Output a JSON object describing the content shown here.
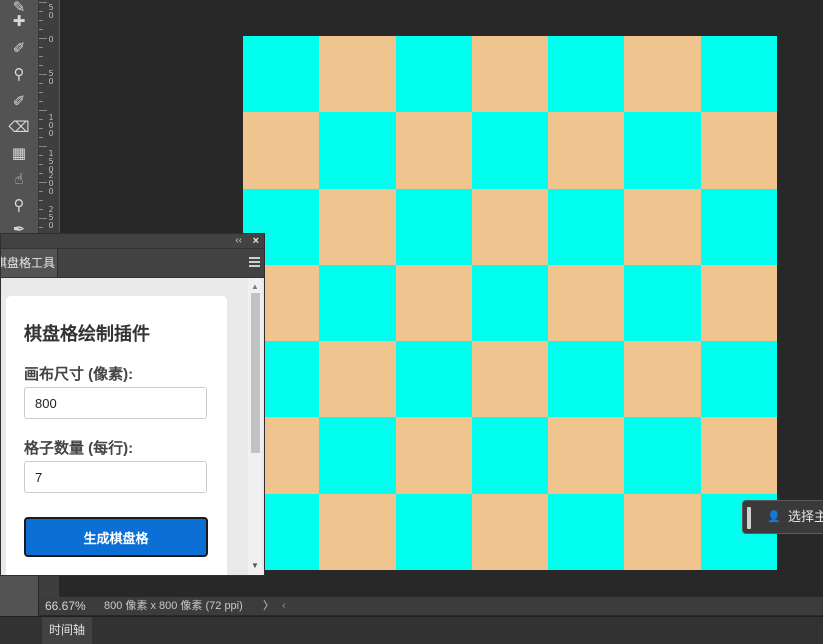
{
  "toolbar": {
    "tools": [
      {
        "icon": "pencil-icon",
        "glyph": "✎"
      },
      {
        "icon": "healing-brush-icon",
        "glyph": "✚"
      },
      {
        "icon": "brush-icon",
        "glyph": "✐"
      },
      {
        "icon": "clone-stamp-icon",
        "glyph": "⚲"
      },
      {
        "icon": "history-brush-icon",
        "glyph": "✐"
      },
      {
        "icon": "eraser-icon",
        "glyph": "⌫"
      },
      {
        "icon": "gradient-icon",
        "glyph": "▦"
      },
      {
        "icon": "smudge-icon",
        "glyph": "☝"
      },
      {
        "icon": "dodge-icon",
        "glyph": "⚲"
      },
      {
        "icon": "pen-icon",
        "glyph": "✒"
      }
    ]
  },
  "ruler": {
    "marks": [
      "5\n0",
      "0",
      "5\n0",
      "1\n0\n0",
      "1\n5\n0",
      "2\n0\n0",
      "2\n5\n0"
    ]
  },
  "canvas": {
    "grid_count": 7,
    "color_a": "#00ffee",
    "color_b": "#f0c48e"
  },
  "panel": {
    "collapse_glyph": "‹‹",
    "close_glyph": "×",
    "tab_label": "棋盘格工具",
    "plugin_title": "棋盘格绘制插件",
    "size_label": "画布尺寸 (像素):",
    "size_value": "800",
    "count_label": "格子数量 (每行):",
    "count_value": "7",
    "generate_button": "生成棋盘格"
  },
  "status": {
    "zoom": "66.67%",
    "doc_info": "800 像素 x 800 像素 (72 ppi)",
    "arrow": "〉",
    "arrow_left": "‹"
  },
  "timeline": {
    "tab_label": "时间轴"
  },
  "floating": {
    "label": "选择主体"
  },
  "colors": {
    "accent_button": "#0b6fd6",
    "app_background": "#282828"
  }
}
